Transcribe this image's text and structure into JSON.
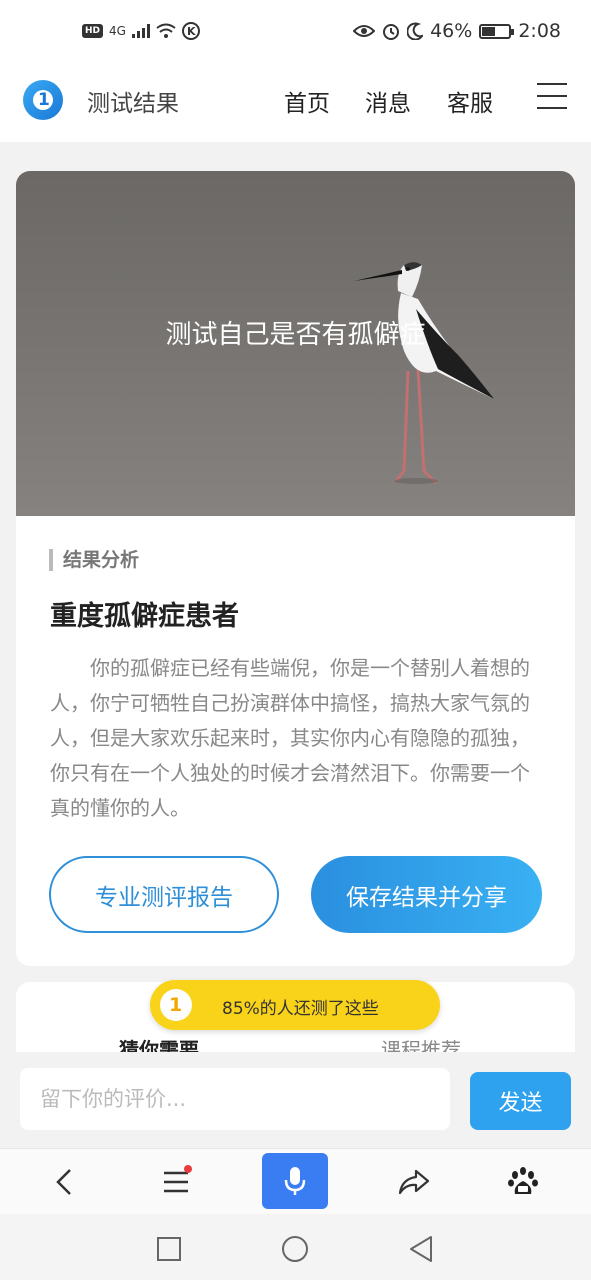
{
  "status_bar": {
    "left_badge": "HD",
    "network": "4G",
    "battery": "46%",
    "battery_level": 0.46,
    "time": "2:08"
  },
  "nav": {
    "logo_glyph": "1",
    "title": "测试结果",
    "links": [
      "首页",
      "消息",
      "客服"
    ]
  },
  "hero": {
    "title": "测试自己是否有孤僻症"
  },
  "result": {
    "section_label": "结果分析",
    "title": "重度孤僻症患者",
    "body": "你的孤僻症已经有些端倪，你是一个替别人着想的人，你宁可牺牲自己扮演群体中搞怪，搞热大家气氛的人，但是大家欢乐起来时，其实你内心有隐隐的孤独，你只有在一个人独处的时候才会潸然泪下。你需要一个真的懂你的人。",
    "btn_report": "专业测评报告",
    "btn_save": "保存结果并分享"
  },
  "recommend": {
    "banner_glyph": "1",
    "banner_text": "85%的人还测了这些",
    "tab_guess": "猜你需要",
    "tab_course": "课程推荐"
  },
  "comment": {
    "placeholder": "留下你的评价...",
    "send": "发送"
  },
  "icons": {
    "accent": "#2f8fd8",
    "mic_bg": "#3a7df2",
    "banner_bg": "#f9d31a"
  }
}
